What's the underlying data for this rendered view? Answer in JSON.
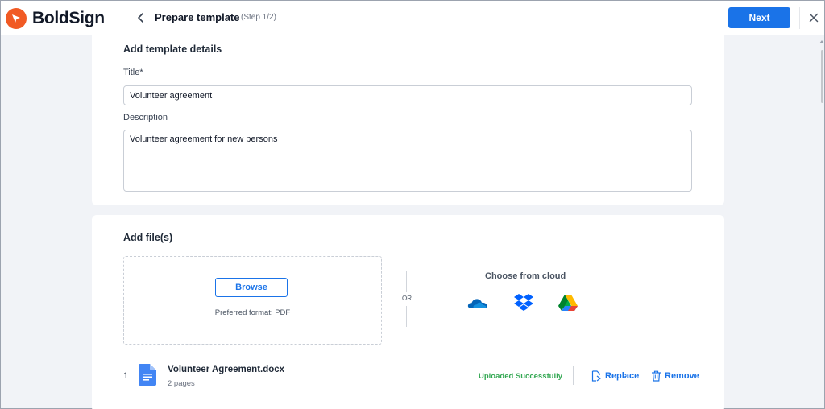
{
  "app": {
    "brand": "BoldSign"
  },
  "header": {
    "title": "Prepare template",
    "step": "(Step 1/2)",
    "next_label": "Next"
  },
  "details": {
    "section_title": "Add template details",
    "title_label": "Title*",
    "title_value": "Volunteer agreement",
    "description_label": "Description",
    "description_value": "Volunteer agreement for new persons"
  },
  "files": {
    "section_title": "Add file(s)",
    "browse_label": "Browse",
    "preferred_format": "Preferred format: PDF",
    "or_label": "OR",
    "cloud_title": "Choose from cloud",
    "cloud_providers": [
      "onedrive-icon",
      "dropbox-icon",
      "google-drive-icon"
    ],
    "items": [
      {
        "index": "1",
        "name": "Volunteer Agreement.docx",
        "pages": "2 pages",
        "status": "Uploaded Successfully",
        "replace_label": "Replace",
        "remove_label": "Remove"
      }
    ]
  },
  "colors": {
    "brand_orange": "#f15a24",
    "primary_blue": "#1a73e8",
    "success_green": "#34a853",
    "page_background": "#f1f3f7"
  }
}
